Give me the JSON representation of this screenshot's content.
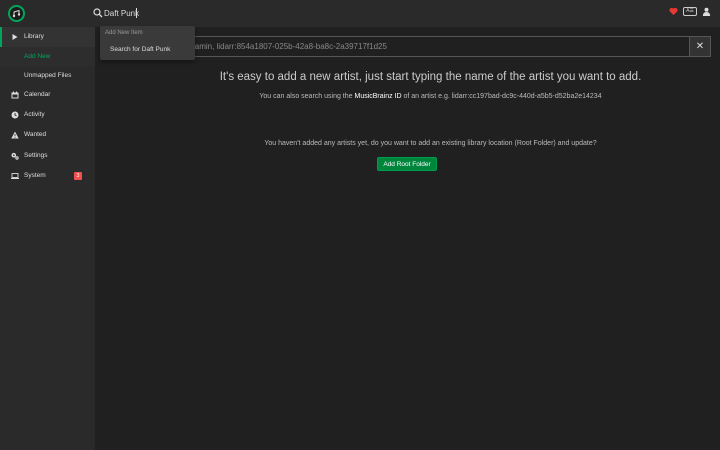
{
  "header": {
    "search_value": "Daft Punk",
    "search_placeholder": "",
    "keyboard_label": "A☰",
    "accent": "#00a65b",
    "heart_color": "#e53935"
  },
  "dropdown": {
    "section_label": "Add New Item",
    "item_label": "Search for Daft Punk"
  },
  "sidebar": {
    "items": [
      {
        "label": "Library",
        "icon": "play-icon"
      },
      {
        "label": "Add New"
      },
      {
        "label": "Unmapped Files"
      },
      {
        "label": "Calendar",
        "icon": "calendar-icon"
      },
      {
        "label": "Activity",
        "icon": "clock-icon"
      },
      {
        "label": "Wanted",
        "icon": "warning-icon"
      },
      {
        "label": "Settings",
        "icon": "gears-icon"
      },
      {
        "label": "System",
        "icon": "laptop-icon",
        "badge": "3"
      }
    ]
  },
  "main": {
    "search_text": "jamin, lidarr:854a1807-025b-42a8-ba8c-2a39717f1d25",
    "clear_label": "✕",
    "title": "It's easy to add a new artist, just start typing the name of the artist you want to add.",
    "subtitle_pre": "You can also search using the ",
    "subtitle_mb": "MusicBrainz ID",
    "subtitle_post": " of an artist e.g. lidarr:cc197bad-dc9c-440d-a5b5-d52ba2e14234",
    "empty_message": "You haven't added any artists yet, do you want to add an existing library location (Root Folder) and update?",
    "add_root_label": "Add Root Folder"
  }
}
